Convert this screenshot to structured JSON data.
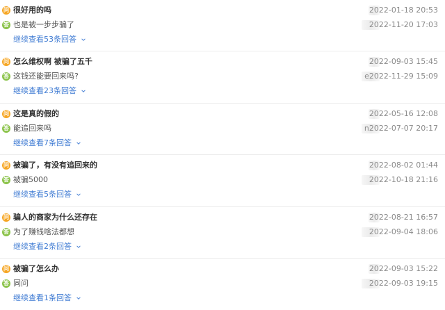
{
  "badges": {
    "ask": "问",
    "answer": "答"
  },
  "items": [
    {
      "question": "很好用的吗",
      "q_prefix": "",
      "q_time": "2022-01-18 20:53",
      "answer": "也是被一步步骗了",
      "a_prefix": "",
      "a_time": "2022-11-20 17:03",
      "more": "继续查看53条回答"
    },
    {
      "question": "怎么维权啊 被骗了五千",
      "q_prefix": "",
      "q_time": "2022-09-03 15:45",
      "answer": "这钱还能要回来吗?",
      "a_prefix": "e",
      "a_time": "2022-11-29 15:09",
      "more": "继续查看23条回答"
    },
    {
      "question": "这是真的假的",
      "q_prefix": "",
      "q_time": "2022-05-16 12:08",
      "answer": "能追回来吗",
      "a_prefix": "n",
      "a_time": "2022-07-07 20:17",
      "more": "继续查看7条回答"
    },
    {
      "question": "被骗了，有没有追回来的",
      "q_prefix": "",
      "q_time": "2022-08-02 01:44",
      "answer": "被骗5000",
      "a_prefix": "",
      "a_time": "2022-10-18 21:16",
      "more": "继续查看5条回答"
    },
    {
      "question": "骗人的商家为什么还存在",
      "q_prefix": "",
      "q_time": "2022-08-21 16:57",
      "answer": "为了赚钱啥法都想",
      "a_prefix": "",
      "a_time": "2022-09-04 18:06",
      "more": "继续查看2条回答"
    },
    {
      "question": "被骗了怎么办",
      "q_prefix": "",
      "q_time": "2022-09-03 15:22",
      "answer": "同问",
      "a_prefix": "",
      "a_time": "2022-09-03 19:15",
      "more": "继续查看1条回答"
    }
  ],
  "colors": {
    "ask_badge": "#f6a623",
    "answer_badge": "#8bc34a",
    "link": "#3f7bd3"
  },
  "icons": {
    "expand": "chevron-down-icon"
  }
}
